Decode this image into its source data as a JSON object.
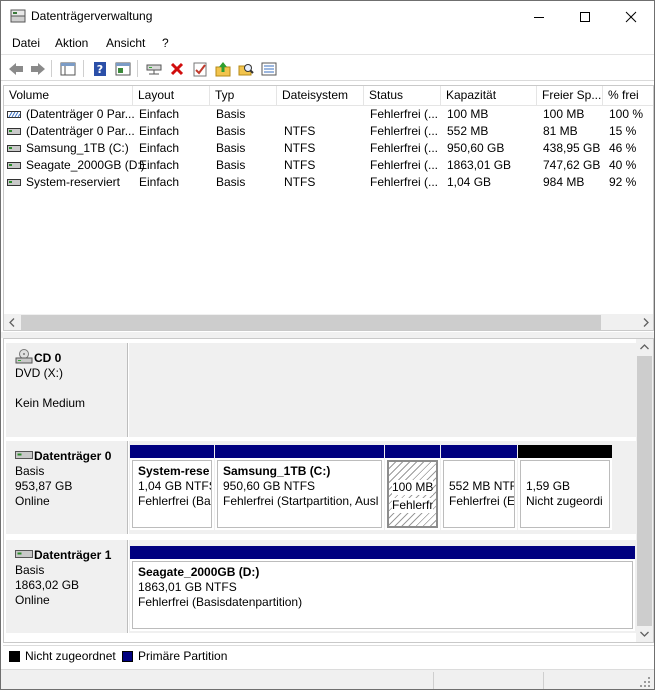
{
  "window": {
    "title": "Datenträgerverwaltung"
  },
  "menu": [
    "Datei",
    "Aktion",
    "Ansicht",
    "?"
  ],
  "volume_list": {
    "columns": [
      "Volume",
      "Layout",
      "Typ",
      "Dateisystem",
      "Status",
      "Kapazität",
      "Freier Sp...",
      "% frei"
    ],
    "rows": [
      [
        "(Datenträger 0 Par...",
        "Einfach",
        "Basis",
        "",
        "Fehlerfrei (...",
        "100 MB",
        "100 MB",
        "100 %"
      ],
      [
        "(Datenträger 0 Par...",
        "Einfach",
        "Basis",
        "NTFS",
        "Fehlerfrei (...",
        "552 MB",
        "81 MB",
        "15 %"
      ],
      [
        "Samsung_1TB (C:)",
        "Einfach",
        "Basis",
        "NTFS",
        "Fehlerfrei (...",
        "950,60 GB",
        "438,95 GB",
        "46 %"
      ],
      [
        "Seagate_2000GB (D:)",
        "Einfach",
        "Basis",
        "NTFS",
        "Fehlerfrei (...",
        "1863,01 GB",
        "747,62 GB",
        "40 %"
      ],
      [
        "System-reserviert",
        "Einfach",
        "Basis",
        "NTFS",
        "Fehlerfrei (...",
        "1,04 GB",
        "984 MB",
        "92 %"
      ]
    ]
  },
  "disks": [
    {
      "name": "CD 0",
      "lines": [
        "DVD (X:)",
        "",
        "Kein Medium"
      ],
      "partitions": []
    },
    {
      "name": "Datenträger 0",
      "lines": [
        "Basis",
        "953,87 GB",
        "Online"
      ],
      "partitions": [
        {
          "lines": [
            "System-rese",
            "1,04 GB NTFS",
            "Fehlerfrei (Ba"
          ],
          "kind": "primary"
        },
        {
          "lines": [
            "Samsung_1TB  (C:)",
            "950,60 GB NTFS",
            "Fehlerfrei (Startpartition, Ausl"
          ],
          "kind": "primary"
        },
        {
          "lines": [
            "",
            "100 MB",
            "Fehlerfr"
          ],
          "kind": "primary",
          "hatched": true
        },
        {
          "lines": [
            "",
            "552 MB NTF",
            "Fehlerfrei (E"
          ],
          "kind": "primary"
        },
        {
          "lines": [
            "",
            "1,59 GB",
            "Nicht zugeordi"
          ],
          "kind": "unallocated"
        }
      ]
    },
    {
      "name": "Datenträger 1",
      "lines": [
        "Basis",
        "1863,02 GB",
        "Online"
      ],
      "partitions": [
        {
          "lines": [
            "Seagate_2000GB  (D:)",
            "1863,01 GB NTFS",
            "Fehlerfrei (Basisdatenpartition)"
          ],
          "kind": "primary"
        }
      ]
    }
  ],
  "legend": [
    {
      "label": "Nicht zugeordnet",
      "color": "#000000"
    },
    {
      "label": "Primäre Partition",
      "color": "#00007f"
    }
  ],
  "colors": {
    "primary_bar": "#00007f",
    "unallocated_bar": "#000000"
  }
}
